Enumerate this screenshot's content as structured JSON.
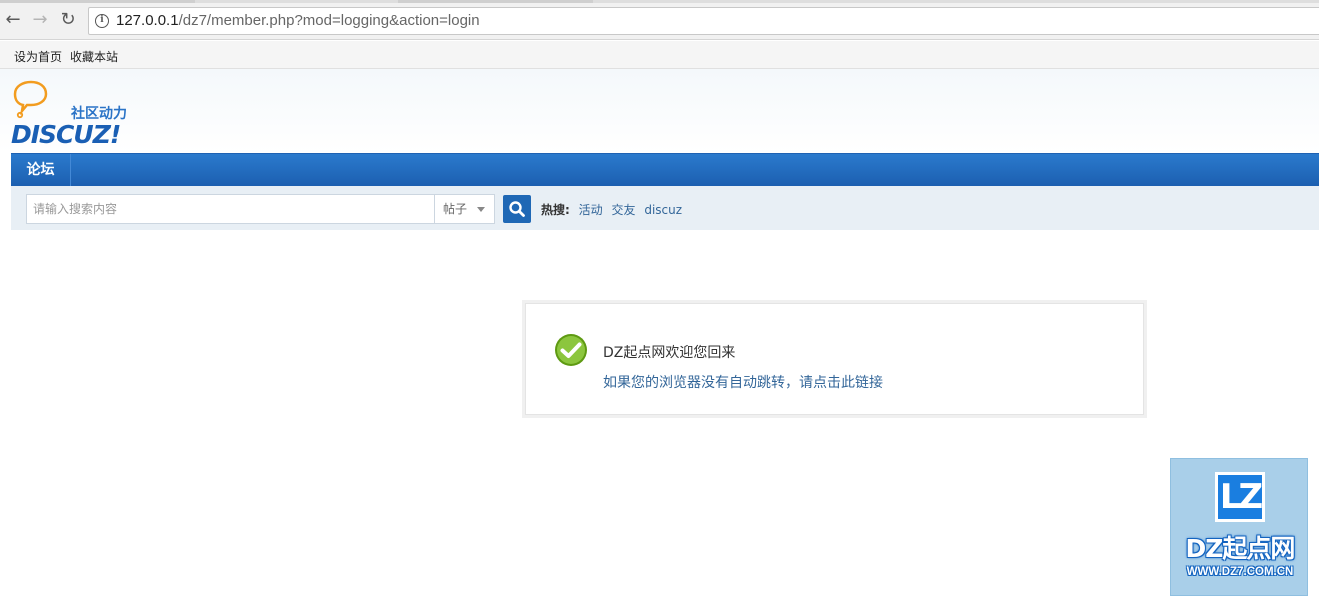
{
  "browser": {
    "url_host": "127.0.0.1",
    "url_path": "/dz7/member.php?mod=logging&action=login"
  },
  "bookmarks": {
    "set_home": "设为首页",
    "favorite": "收藏本站"
  },
  "logo": {
    "tagline": "社区动力",
    "brand": "DISCUZ!"
  },
  "nav": {
    "forum": "论坛"
  },
  "search": {
    "placeholder": "请输入搜索内容",
    "type_selected": "帖子",
    "hot_label": "热搜:",
    "hot_terms": [
      "活动",
      "交友",
      "discuz"
    ]
  },
  "message": {
    "title": "DZ起点网欢迎您回来",
    "redirect_link": "如果您的浏览器没有自动跳转，请点击此链接"
  },
  "badge": {
    "mark": "LZ",
    "brand": "DZ起点网",
    "site": "WWW.DZ7.COM.CN"
  },
  "colors": {
    "nav_blue": "#1c5fb0",
    "link_blue": "#336699",
    "success_green": "#7cbf1e"
  }
}
